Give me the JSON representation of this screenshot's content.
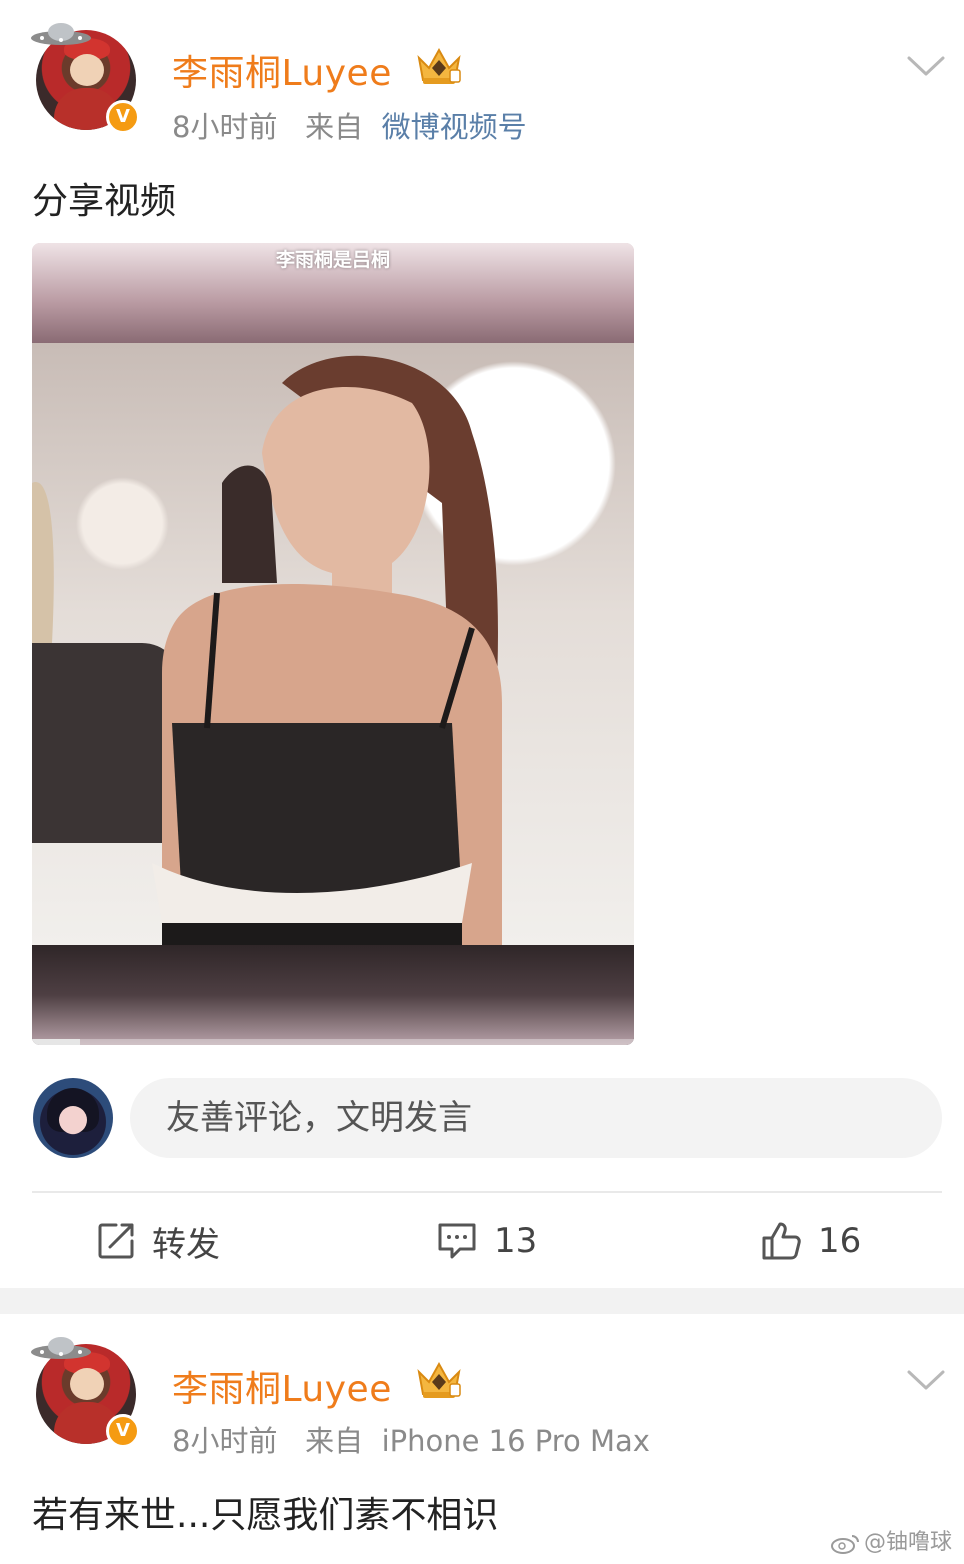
{
  "posts": [
    {
      "username": "李雨桐Luyee",
      "time": "8小时前",
      "from_label": "来自",
      "source": "微博视频号",
      "text": "分享视频",
      "video": {
        "caption": "李雨桐是吕桐",
        "progress": 0.08
      },
      "comment_placeholder": "友善评论，文明发言",
      "actions": {
        "repost_label": "转发",
        "comments_count": "13",
        "likes_count": "16"
      }
    },
    {
      "username": "李雨桐Luyee",
      "time": "8小时前",
      "from_label": "来自",
      "source": "iPhone 16 Pro Max",
      "text": "若有来世...只愿我们素不相识"
    }
  ],
  "watermark": "@铀噜球",
  "colors": {
    "username": "#ef7c1b",
    "source_link": "#5a7fa8",
    "meta_gray": "#8a8a8a",
    "verified_badge": "#f59b12"
  },
  "icons": {
    "verified": "v-badge-icon",
    "crown": "crown-icon",
    "ufo": "ufo-icon",
    "more": "chevron-down-icon",
    "repost": "repost-icon",
    "comment": "comment-icon",
    "like": "thumbs-up-icon",
    "weibo": "weibo-logo-icon"
  }
}
